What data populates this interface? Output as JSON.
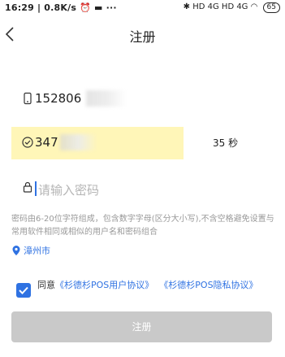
{
  "status_bar": {
    "time": "16:29",
    "speed": "0.8K/s",
    "signal_text": "HD 4G HD 4G",
    "battery": "65"
  },
  "nav": {
    "title": "注册"
  },
  "phone": {
    "value": "152806"
  },
  "code": {
    "value": "347",
    "countdown": "35 秒"
  },
  "password": {
    "placeholder": "请输入密码",
    "hint": "密码由6-20位字符组成，包含数字字母(区分大小写),不含空格避免设置与常用软件相同或相似的用户名和密码组合"
  },
  "location": {
    "city": "漳州市"
  },
  "agreement": {
    "prefix": "同意",
    "user_agreement": "《杉德杉POS用户协议》",
    "privacy_agreement": "《杉德杉POS隐私协议》",
    "checked": true
  },
  "register_button": "注册",
  "colors": {
    "accent": "#2f72e2",
    "code_highlight": "#fff6b8",
    "button_disabled": "#c9c9c9"
  }
}
